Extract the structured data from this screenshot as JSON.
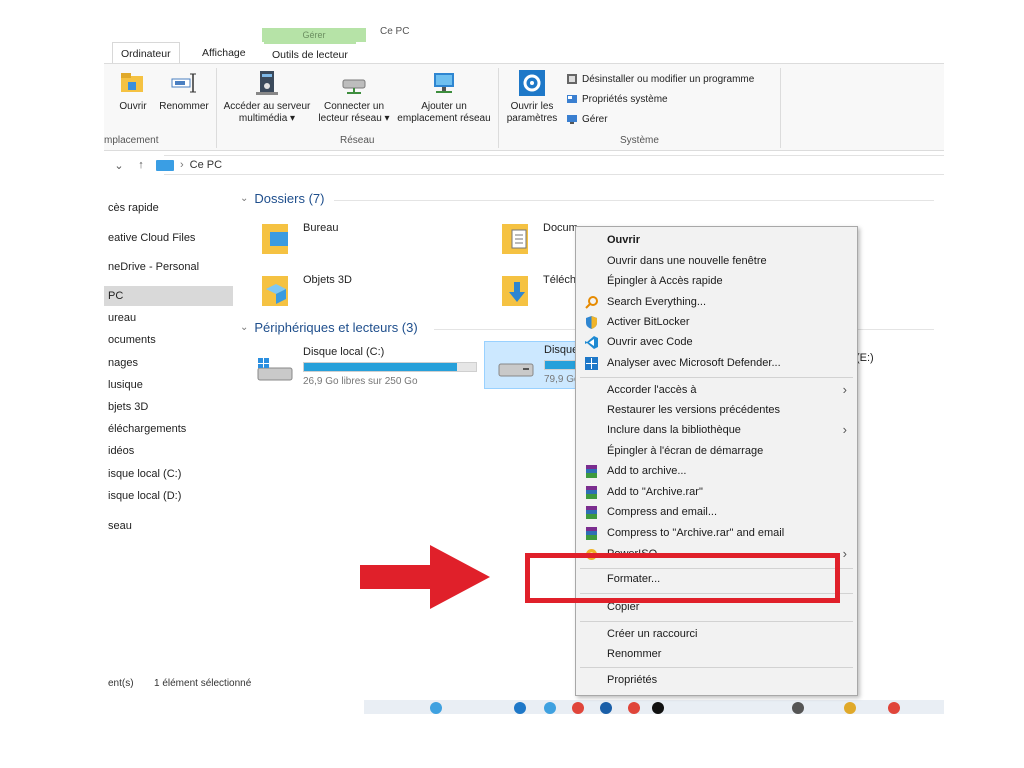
{
  "window": {
    "title_partial": "Ce PC",
    "context_header": "Gérer"
  },
  "tabs": [
    "Ordinateur",
    "Affichage",
    "Outils de lecteur"
  ],
  "ribbon": {
    "emplacement": {
      "label": "mplacement",
      "buttons": [
        "Ouvrir",
        "Renommer"
      ]
    },
    "reseau": {
      "label": "Réseau",
      "buttons": [
        {
          "line1": "Accéder au serveur",
          "line2": "multimédia ▾"
        },
        {
          "line1": "Connecter un",
          "line2": "lecteur réseau ▾"
        },
        {
          "line1": "Ajouter un",
          "line2": "emplacement réseau"
        }
      ]
    },
    "systeme": {
      "label": "Système",
      "big": {
        "line1": "Ouvrir les",
        "line2": "paramètres"
      },
      "small": [
        "Désinstaller ou modifier un programme",
        "Propriétés système",
        "Gérer"
      ]
    }
  },
  "address": {
    "path": "Ce PC"
  },
  "nav": [
    "cès rapide",
    "eative Cloud Files",
    "neDrive - Personal",
    "PC",
    "ureau",
    "ocuments",
    "nages",
    "lusique",
    "bjets 3D",
    "éléchargements",
    "idéos",
    "isque local (C:)",
    "isque local (D:)",
    "seau"
  ],
  "folders_section": {
    "title": "Dossiers (7)",
    "items": [
      "Bureau",
      "Docum",
      "Objets 3D",
      "Télécha"
    ]
  },
  "drives_section": {
    "title": "Périphériques et lecteurs (3)",
    "drives": [
      {
        "name": "Disque local (C:)",
        "free": "26,9 Go libres sur 250 Go",
        "used_fraction": 0.89
      },
      {
        "name": "Disque",
        "free": "79,9 Go",
        "used_fraction": 0.4
      }
    ],
    "third_partial": "(E:)"
  },
  "status": {
    "count": "ent(s)",
    "selected": "1 élément sélectionné"
  },
  "context_menu": {
    "items": [
      {
        "label": "Ouvrir",
        "bold": true
      },
      {
        "label": "Ouvrir dans une nouvelle fenêtre"
      },
      {
        "label": "Épingler à Accès rapide"
      },
      {
        "label": "Search Everything...",
        "icon": "search-everything-icon"
      },
      {
        "label": "Activer BitLocker",
        "icon": "bitlocker-shield-icon"
      },
      {
        "label": "Ouvrir avec Code",
        "icon": "vscode-icon"
      },
      {
        "label": "Analyser avec Microsoft Defender...",
        "icon": "defender-icon"
      },
      {
        "label": "Accorder l'accès à",
        "submenu": true
      },
      {
        "label": "Restaurer les versions précédentes"
      },
      {
        "label": "Inclure dans la bibliothèque",
        "submenu": true
      },
      {
        "label": "Épingler à l'écran de démarrage"
      },
      {
        "label": "Add to archive...",
        "icon": "winrar-icon"
      },
      {
        "label": "Add to \"Archive.rar\"",
        "icon": "winrar-icon"
      },
      {
        "label": "Compress and email...",
        "icon": "winrar-icon"
      },
      {
        "label": "Compress to \"Archive.rar\" and email",
        "icon": "winrar-icon"
      },
      {
        "label": "PowerISO",
        "submenu": true,
        "icon": "poweriso-icon"
      },
      {
        "label": "Formater..."
      },
      {
        "label": "Copier"
      },
      {
        "label": "Créer un raccourci"
      },
      {
        "label": "Renommer"
      },
      {
        "label": "Propriétés"
      }
    ]
  },
  "colors": {
    "accent": "#26a0da",
    "annotation_red": "#e0202a",
    "section_blue": "#1e4e8c"
  }
}
